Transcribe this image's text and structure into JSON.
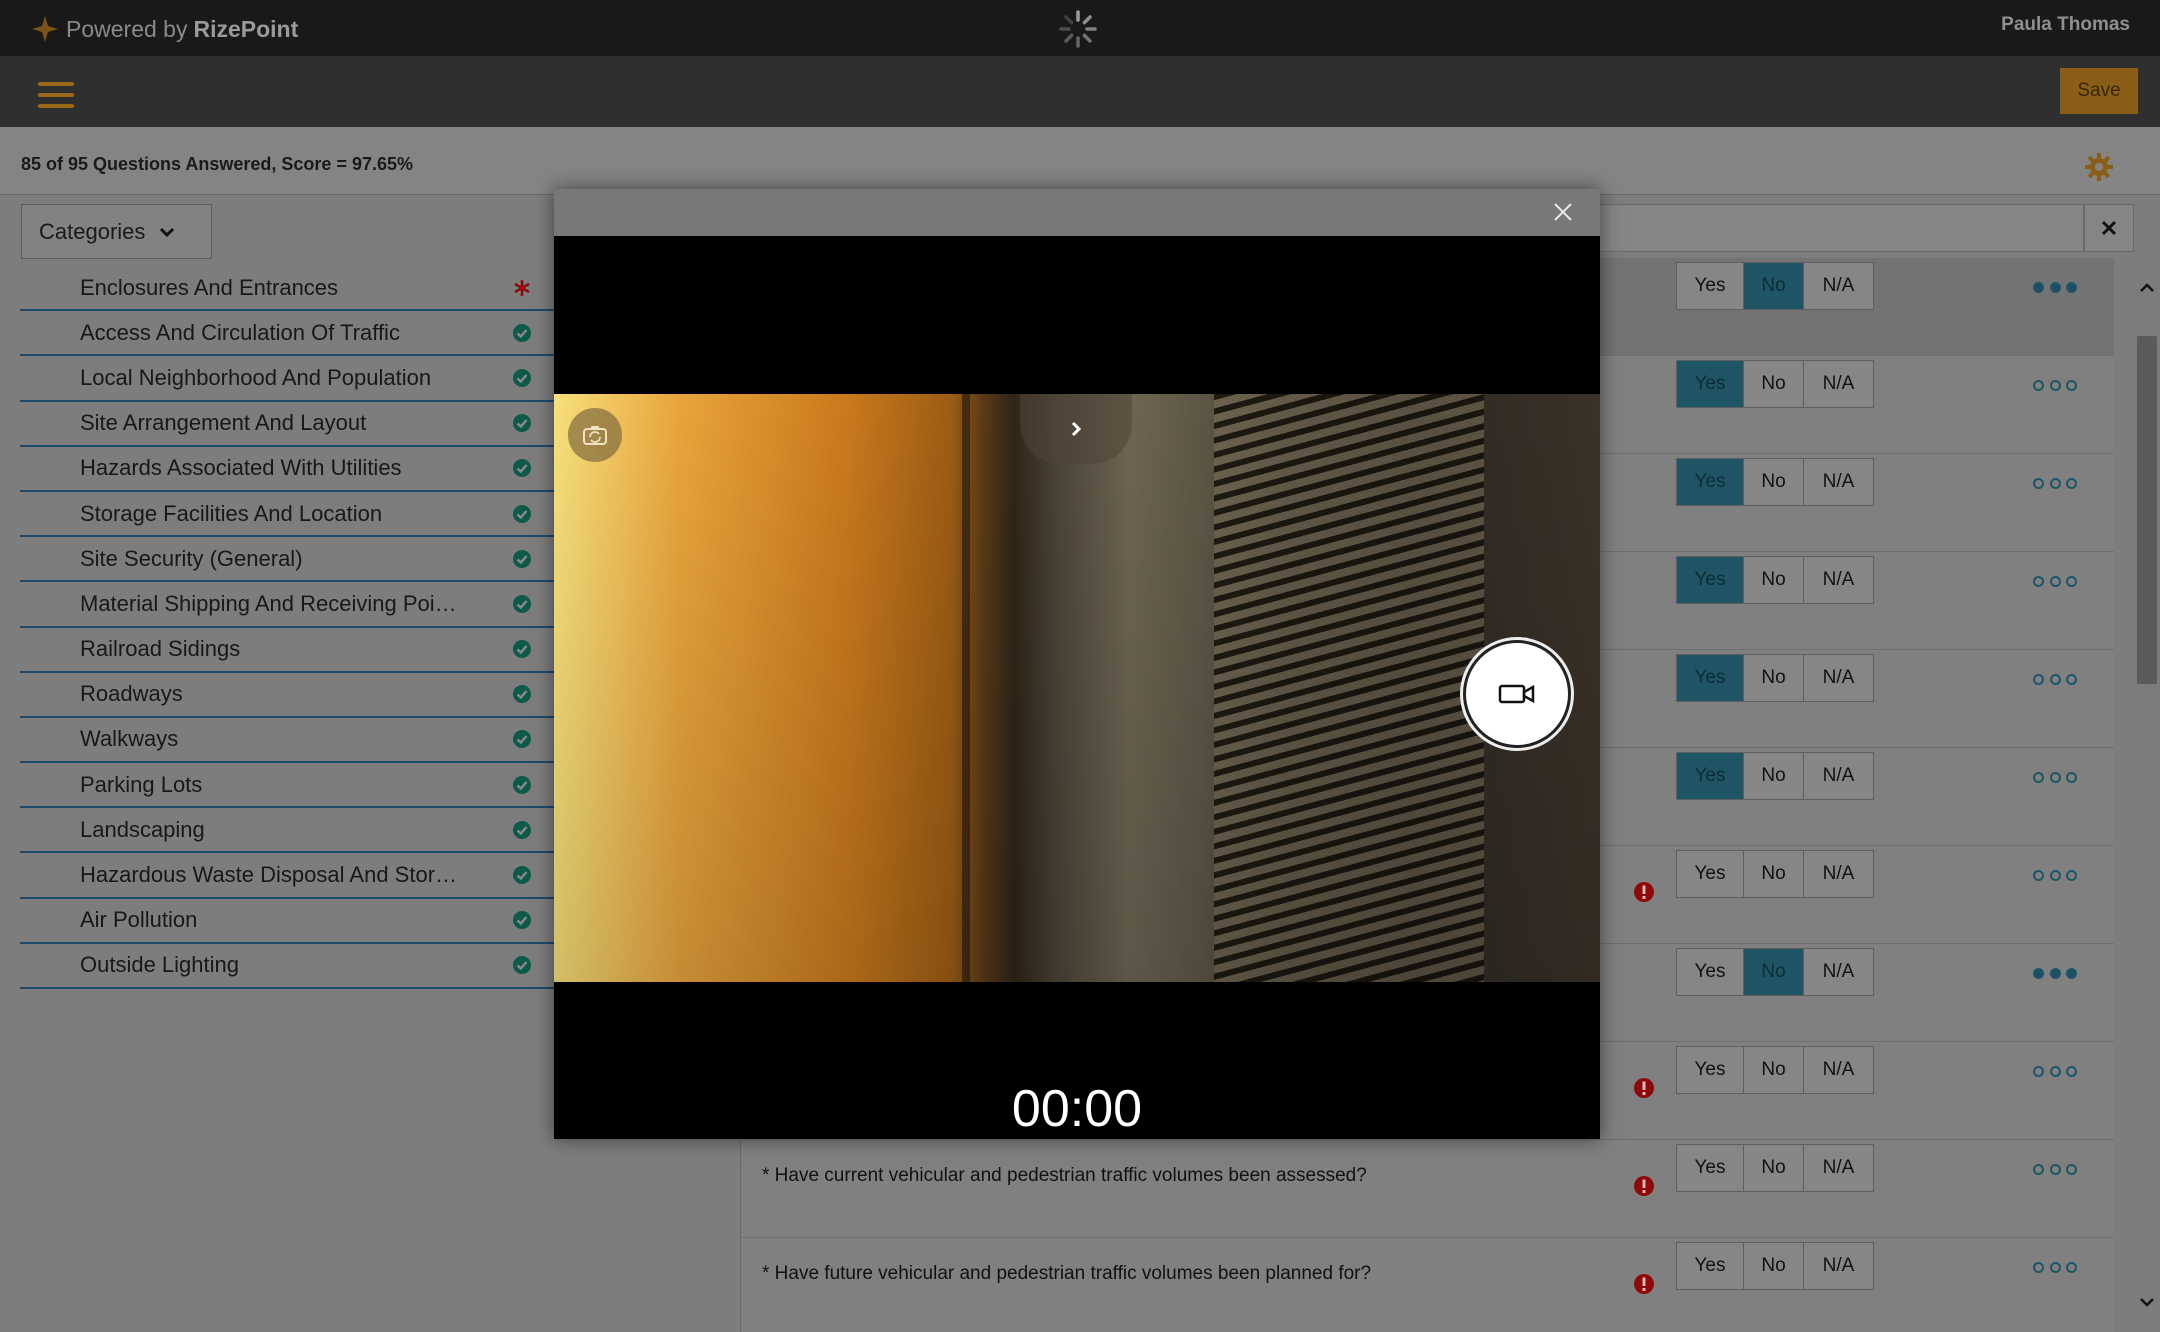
{
  "header": {
    "brand_prefix": "Powered by",
    "brand_name": "RizePoint",
    "user_name": "Paula Thomas"
  },
  "toolbar": {
    "save_label": "Save"
  },
  "score": {
    "text": "85 of 95 Questions Answered, Score = 97.65%"
  },
  "sidebar": {
    "categories_label": "Categories",
    "items": [
      {
        "label": "Enclosures And Entrances",
        "status": "required-icon"
      },
      {
        "label": "Access And Circulation Of Traffic",
        "status": "check-icon"
      },
      {
        "label": "Local Neighborhood And Population",
        "status": "check-icon"
      },
      {
        "label": "Site Arrangement And Layout",
        "status": "check-icon"
      },
      {
        "label": "Hazards Associated With Utilities",
        "status": "check-icon"
      },
      {
        "label": "Storage Facilities And Location",
        "status": "check-icon"
      },
      {
        "label": "Site Security (General)",
        "status": "check-icon"
      },
      {
        "label": "Material Shipping And Receiving Poi…",
        "status": "check-icon"
      },
      {
        "label": "Railroad Sidings",
        "status": "check-icon"
      },
      {
        "label": "Roadways",
        "status": "check-icon"
      },
      {
        "label": "Walkways",
        "status": "check-icon"
      },
      {
        "label": "Parking Lots",
        "status": "check-icon"
      },
      {
        "label": "Landscaping",
        "status": "check-icon"
      },
      {
        "label": "Hazardous Waste Disposal And Stor…",
        "status": "check-icon"
      },
      {
        "label": "Air Pollution",
        "status": "check-icon"
      },
      {
        "label": "Outside Lighting",
        "status": "check-icon"
      }
    ]
  },
  "questions": {
    "answer_labels": {
      "yes": "Yes",
      "no": "No",
      "na": "N/A"
    },
    "rows": [
      {
        "text": "",
        "answer": "No",
        "warning": false,
        "more_filled": true,
        "highlight": true
      },
      {
        "text": "",
        "answer": "Yes",
        "warning": false,
        "more_filled": false,
        "highlight": false
      },
      {
        "text": "",
        "answer": "Yes",
        "warning": false,
        "more_filled": false,
        "highlight": false
      },
      {
        "text": "",
        "answer": "Yes",
        "warning": false,
        "more_filled": false,
        "highlight": false
      },
      {
        "text": "",
        "answer": "Yes",
        "warning": false,
        "more_filled": false,
        "highlight": false
      },
      {
        "text": "",
        "answer": "Yes",
        "warning": false,
        "more_filled": false,
        "highlight": false
      },
      {
        "text": "",
        "answer": "",
        "warning": true,
        "more_filled": false,
        "highlight": false
      },
      {
        "text": "",
        "answer": "No",
        "warning": false,
        "more_filled": true,
        "highlight": false
      },
      {
        "text": "",
        "answer": "",
        "warning": true,
        "more_filled": false,
        "highlight": false
      },
      {
        "text": "* Have current vehicular and pedestrian traffic volumes been assessed?",
        "answer": "",
        "warning": true,
        "more_filled": false,
        "highlight": false
      },
      {
        "text": "* Have future vehicular and pedestrian traffic volumes been planned for?",
        "answer": "",
        "warning": true,
        "more_filled": false,
        "highlight": false
      }
    ]
  },
  "camera_modal": {
    "timer": "00:00",
    "icons": [
      "close-icon",
      "flip-camera-icon",
      "chevron-right-icon",
      "video-camera-icon"
    ]
  },
  "colors": {
    "accent": "#8a5e16",
    "selected_answer": "#1e5463",
    "check": "#0e5a4a",
    "warning": "#8e0a0a"
  }
}
